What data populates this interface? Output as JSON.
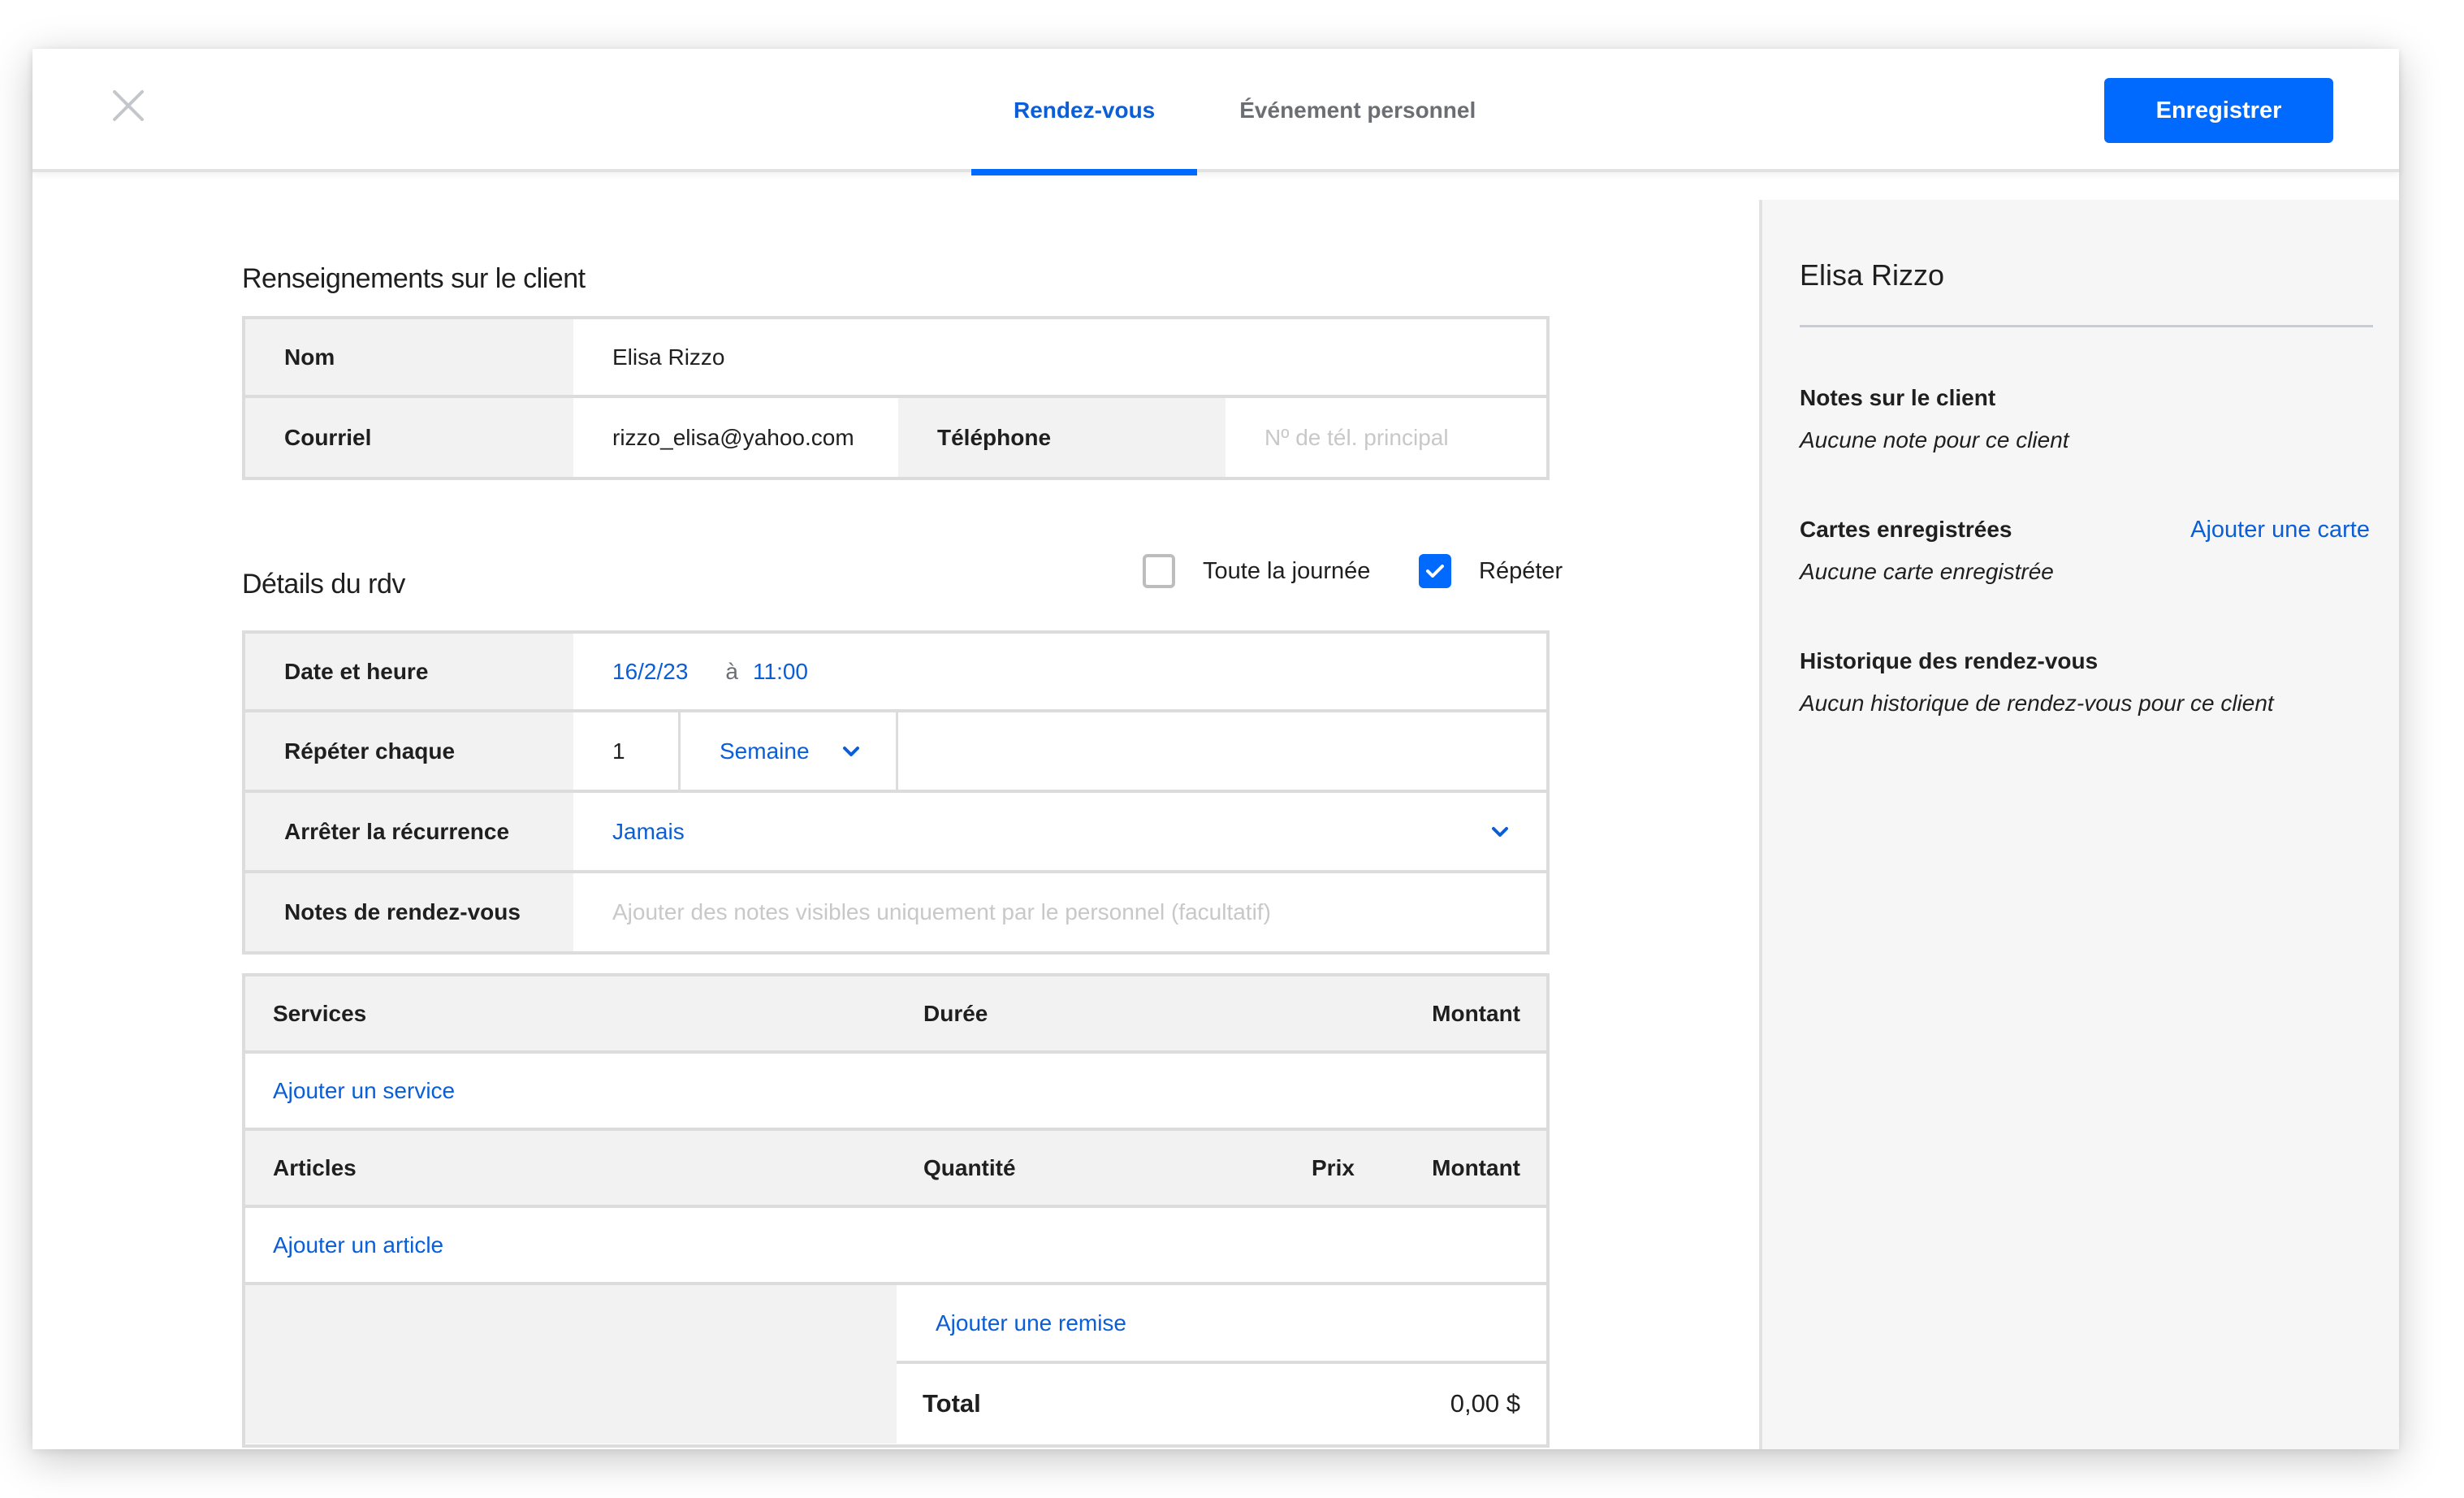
{
  "header": {
    "close_icon": "close-icon",
    "tabs": [
      {
        "label": "Rendez-vous",
        "active": true
      },
      {
        "label": "Événement personnel",
        "active": false
      }
    ],
    "save_label": "Enregistrer"
  },
  "client_info": {
    "title": "Renseignements sur le client",
    "name_label": "Nom",
    "name_value": "Elisa Rizzo",
    "email_label": "Courriel",
    "email_value": "rizzo_elisa@yahoo.com",
    "phone_label": "Téléphone",
    "phone_placeholder": "Nº de tél. principal"
  },
  "appointment": {
    "title": "Détails du rdv",
    "all_day_label": "Toute la journée",
    "all_day_checked": false,
    "repeat_label": "Répéter",
    "repeat_checked": true,
    "date_label": "Date et heure",
    "date_value": "16/2/23",
    "at_label": "à",
    "time_value": "11:00",
    "repeat_every_label": "Répéter chaque",
    "repeat_every_count": "1",
    "repeat_every_unit": "Semaine",
    "stop_label": "Arrêter la récurrence",
    "stop_value": "Jamais",
    "notes_label": "Notes de rendez-vous",
    "notes_placeholder": "Ajouter des notes visibles uniquement par le personnel (facultatif)"
  },
  "services": {
    "header": {
      "name": "Services",
      "duration": "Durée",
      "amount": "Montant"
    },
    "add_label": "Ajouter un service"
  },
  "articles": {
    "header": {
      "name": "Articles",
      "quantity": "Quantité",
      "price": "Prix",
      "amount": "Montant"
    },
    "add_label": "Ajouter un article"
  },
  "summary": {
    "discount_label": "Ajouter une remise",
    "total_label": "Total",
    "total_value": "0,00 $"
  },
  "sidebar": {
    "client_name": "Elisa Rizzo",
    "notes_title": "Notes sur le client",
    "notes_text": "Aucune note pour ce client",
    "cards_title": "Cartes enregistrées",
    "add_card_label": "Ajouter une carte",
    "cards_text": "Aucune carte enregistrée",
    "history_title": "Historique des rendez-vous",
    "history_text": "Aucun historique de rendez-vous pour ce client"
  },
  "colors": {
    "accent": "#006aff",
    "link": "#0a5ed7",
    "label_bg": "#f2f2f2",
    "sidebar_bg": "#f6f6f6"
  }
}
